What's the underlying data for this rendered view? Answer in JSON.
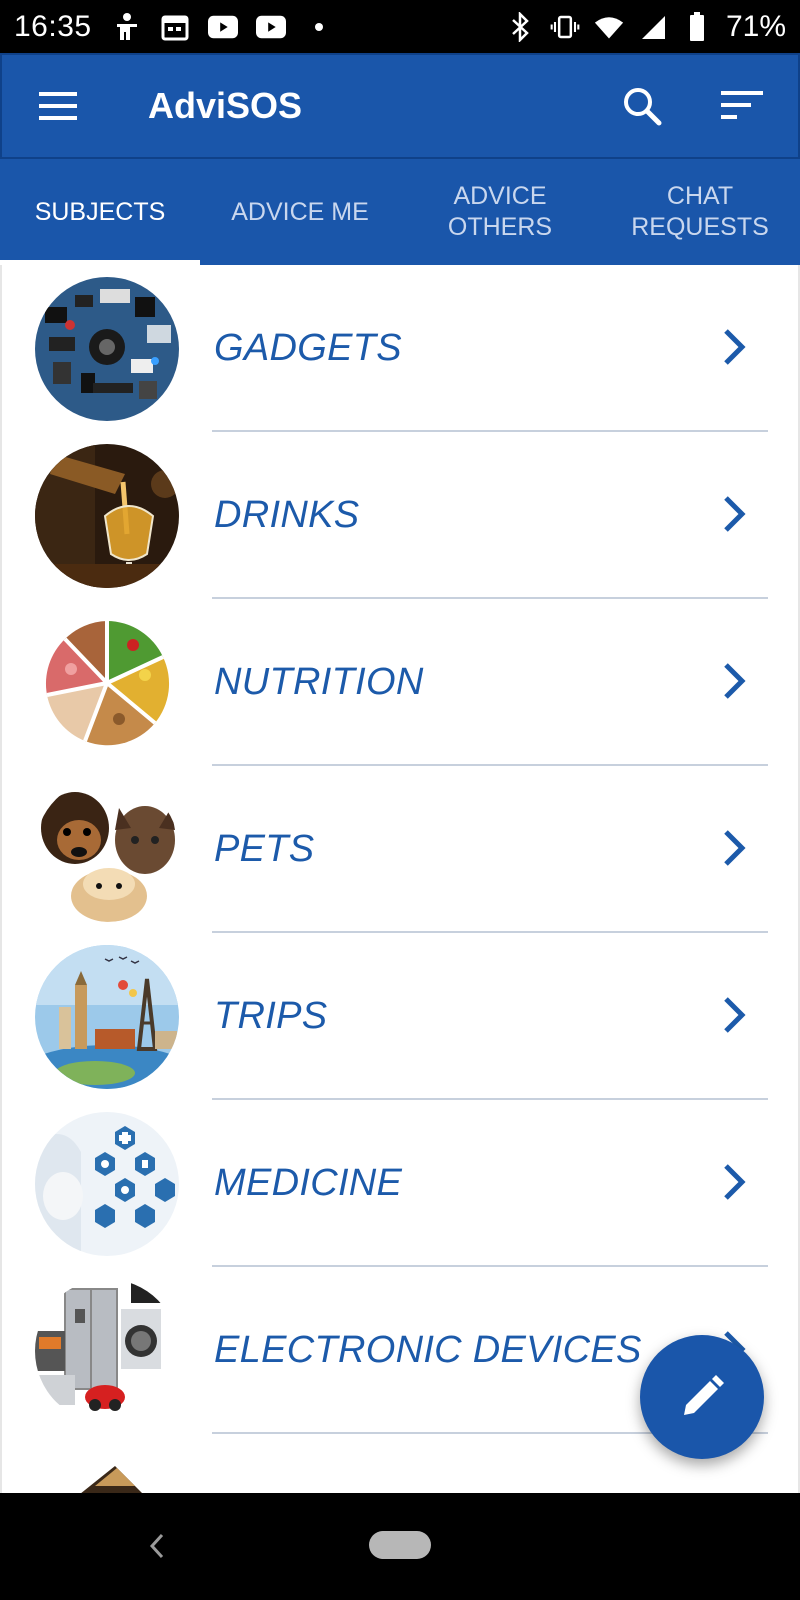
{
  "status_bar": {
    "time": "16:35",
    "battery": "71%",
    "left_icons": [
      "accessibility-icon",
      "calendar-icon",
      "youtube-icon",
      "youtube-icon",
      "dot-icon"
    ],
    "right_icons": [
      "bluetooth-icon",
      "vibrate-icon",
      "wifi-icon",
      "signal-icon",
      "battery-icon"
    ]
  },
  "app_bar": {
    "title": "AdviSOS",
    "icons": [
      "menu-icon",
      "search-icon",
      "sort-icon"
    ]
  },
  "tabs": [
    {
      "label": "SUBJECTS",
      "active": true
    },
    {
      "label": "ADVICE ME",
      "active": false
    },
    {
      "label": "ADVICE OTHERS",
      "active": false
    },
    {
      "label": "CHAT REQUESTS",
      "active": false
    }
  ],
  "subjects": [
    {
      "label": "GADGETS",
      "icon": "gadgets-thumbnail"
    },
    {
      "label": "DRINKS",
      "icon": "drinks-thumbnail"
    },
    {
      "label": "NUTRITION",
      "icon": "nutrition-thumbnail"
    },
    {
      "label": "PETS",
      "icon": "pets-thumbnail"
    },
    {
      "label": "TRIPS",
      "icon": "trips-thumbnail"
    },
    {
      "label": "MEDICINE",
      "icon": "medicine-thumbnail"
    },
    {
      "label": "ELECTRONIC DEVICES",
      "icon": "electronic-devices-thumbnail"
    }
  ],
  "fab": {
    "icon": "pencil-icon"
  },
  "nav_bar": {
    "icons": [
      "back-icon",
      "home-pill-icon"
    ]
  },
  "colors": {
    "primary": "#1a56aa",
    "text_accent": "#1c5aaa",
    "divider": "#c7d0dd"
  }
}
